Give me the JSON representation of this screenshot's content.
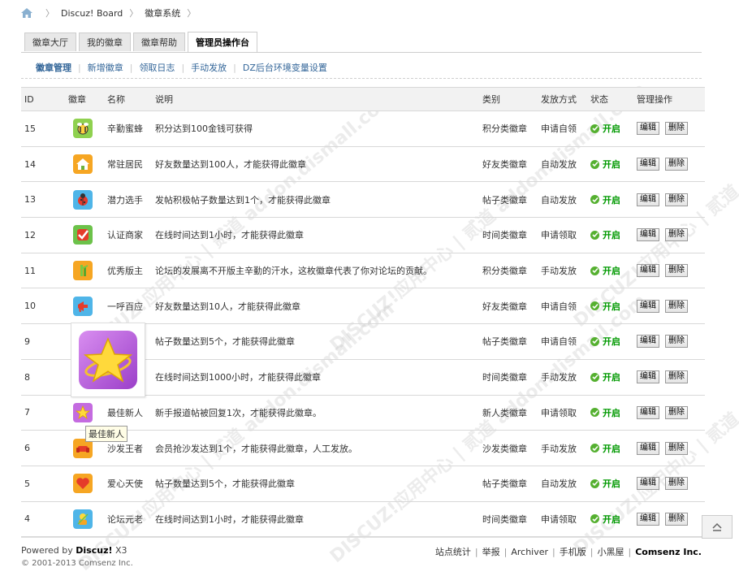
{
  "breadcrumb": {
    "items": [
      "Discuz! Board",
      "徽章系统"
    ]
  },
  "tabs": [
    {
      "label": "徽章大厅",
      "active": false
    },
    {
      "label": "我的徽章",
      "active": false
    },
    {
      "label": "徽章帮助",
      "active": false
    },
    {
      "label": "管理员操作台",
      "active": true
    }
  ],
  "subnav": [
    "徽章管理",
    "新增徽章",
    "领取日志",
    "手动发放",
    "DZ后台环境变量设置"
  ],
  "table": {
    "headers": [
      "ID",
      "徽章",
      "名称",
      "说明",
      "类别",
      "发放方式",
      "状态",
      "管理操作"
    ],
    "rows": [
      {
        "id": "15",
        "icon": "bee-badge-icon",
        "name": "辛勤蜜蜂",
        "desc": "积分达到100金钱可获得",
        "type": "积分类徽章",
        "mode": "申请自领",
        "status": "开启"
      },
      {
        "id": "14",
        "icon": "house-badge-icon",
        "name": "常驻居民",
        "desc": "好友数量达到100人，才能获得此徽章",
        "type": "好友类徽章",
        "mode": "自动发放",
        "status": "开启"
      },
      {
        "id": "13",
        "icon": "ladybug-badge-icon",
        "name": "潜力选手",
        "desc": "发帖积极帖子数量达到1个，才能获得此徽章",
        "type": "帖子类徽章",
        "mode": "自动发放",
        "status": "开启"
      },
      {
        "id": "12",
        "icon": "checkmark-badge-icon",
        "name": "认证商家",
        "desc": "在线时间达到1小时，才能获得此徽章",
        "type": "时间类徽章",
        "mode": "申请领取",
        "status": "开启"
      },
      {
        "id": "11",
        "icon": "bamboo-badge-icon",
        "name": "优秀版主",
        "desc": "论坛的发展离不开版主辛勤的汗水，这枚徽章代表了你对论坛的贡献。",
        "type": "积分类徽章",
        "mode": "手动发放",
        "status": "开启"
      },
      {
        "id": "10",
        "icon": "megaphone-badge-icon",
        "name": "一呼百应",
        "desc": "好友数量达到10人，才能获得此徽章",
        "type": "好友类徽章",
        "mode": "申请自领",
        "status": "开启"
      },
      {
        "id": "9",
        "icon": "",
        "name": "",
        "desc": "帖子数量达到5个，才能获得此徽章",
        "type": "帖子类徽章",
        "mode": "申请自领",
        "status": "开启"
      },
      {
        "id": "8",
        "icon": "",
        "name": "",
        "desc": "在线时间达到1000小时，才能获得此徽章",
        "type": "时间类徽章",
        "mode": "手动发放",
        "status": "开启"
      },
      {
        "id": "7",
        "icon": "star-badge-icon",
        "name": "最佳新人",
        "desc": "新手报道帖被回复1次，才能获得此徽章。",
        "type": "新人类徽章",
        "mode": "申请领取",
        "status": "开启"
      },
      {
        "id": "6",
        "icon": "sofa-badge-icon",
        "name": "沙发王者",
        "desc": "会员抢沙发达到1个，才能获得此徽章，人工发放。",
        "type": "沙发类徽章",
        "mode": "手动发放",
        "status": "开启"
      },
      {
        "id": "5",
        "icon": "heart-badge-icon",
        "name": "爱心天使",
        "desc": "帖子数量达到5个，才能获得此徽章",
        "type": "帖子类徽章",
        "mode": "自动发放",
        "status": "开启"
      },
      {
        "id": "4",
        "icon": "elder-badge-icon",
        "name": "论坛元老",
        "desc": "在线时间达到1小时，才能获得此徽章",
        "type": "时间类徽章",
        "mode": "申请领取",
        "status": "开启"
      }
    ],
    "edit_label": "编辑",
    "delete_label": "删除"
  },
  "tooltip": "最佳新人",
  "watermark": "DISCUZ!应用中心 | 贰道 addon.dismall.com",
  "footer": {
    "powered_prefix": "Powered by ",
    "powered_brand": "Discuz!",
    "powered_version": " X3",
    "links": [
      "站点统计",
      "举报",
      "Archiver",
      "手机版",
      "小黑屋"
    ],
    "company": "Comsenz Inc.",
    "copyright": "© 2001-2013 Comsenz Inc."
  },
  "colors": {
    "tab_border": "#cdcdcd",
    "link": "#336699",
    "status_green": "#009900"
  }
}
